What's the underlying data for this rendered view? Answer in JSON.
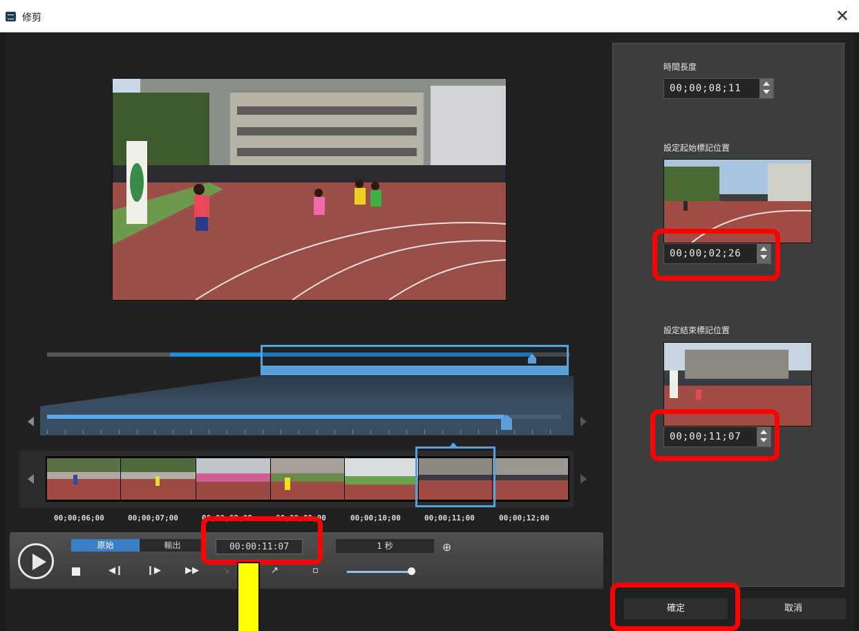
{
  "window": {
    "title": "修剪",
    "close_symbol": "✕"
  },
  "timeline": {
    "timecodes": [
      "00;00;06;00",
      "00;00;07;00",
      "00;00;08;00",
      "00;00;09;00",
      "00;00;10;00",
      "00;00;11;00",
      "00;00;12;00"
    ]
  },
  "controls": {
    "source_tab": "原始",
    "output_tab": "輸出",
    "current_time": "00:00:11:07",
    "step": "1 秒",
    "volume_level": 0.95
  },
  "right_panel": {
    "duration_label": "時間長度",
    "duration_value": "00;00;08;11",
    "start_label": "設定起始標記位置",
    "start_value": "00;00;02;26",
    "end_label": "設定結束標記位置",
    "end_value": "00;00;11;07"
  },
  "buttons": {
    "ok": "確定",
    "cancel": "取消"
  }
}
